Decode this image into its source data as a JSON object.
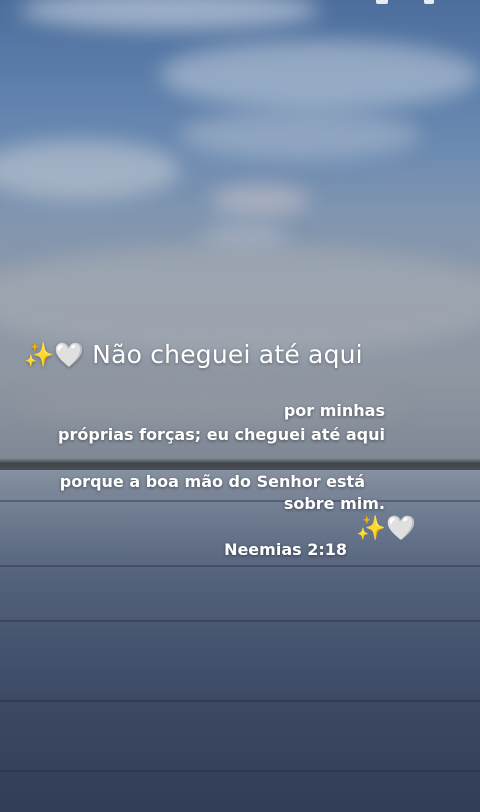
{
  "post": {
    "headline_emoji": "✨🤍",
    "headline_text": "Não cheguei até aqui",
    "lines": [
      "por minhas",
      "próprias forças; eu cheguei até aqui",
      "porque a boa mão do Senhor está",
      "sobre mim."
    ],
    "closing_emoji": "✨🤍",
    "reference": "Neemias 2:18"
  }
}
